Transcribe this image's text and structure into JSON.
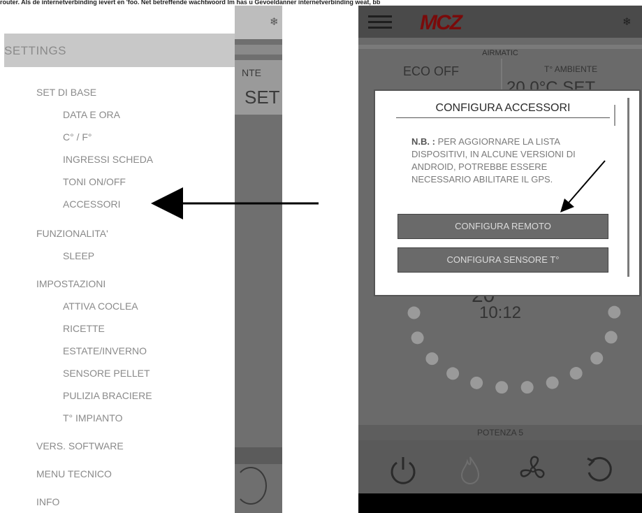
{
  "caption": "router. Als de internetverbinding ievert en 'foo. Net betreffende wachtwoord lm has u Gevoeldanner internetverbinding weat, bb",
  "left": {
    "drawer_title": "SETTINGS",
    "menu": [
      {
        "label": "SET DI BASE"
      },
      {
        "label": "DATA E ORA"
      },
      {
        "label": "C° / F°"
      },
      {
        "label": "INGRESSI SCHEDA"
      },
      {
        "label": "TONI ON/OFF"
      },
      {
        "label": "ACCESSORI"
      },
      {
        "label": "FUNZIONALITA'"
      },
      {
        "label": "SLEEP"
      },
      {
        "label": "IMPOSTAZIONI"
      },
      {
        "label": "ATTIVA COCLEA"
      },
      {
        "label": "RICETTE"
      },
      {
        "label": "ESTATE/INVERNO"
      },
      {
        "label": "SENSORE PELLET"
      },
      {
        "label": "PULIZIA BRACIERE"
      },
      {
        "label": "T° IMPIANTO"
      },
      {
        "label": "VERS. SOFTWARE"
      },
      {
        "label": "MENU TECNICO"
      },
      {
        "label": "INFO"
      }
    ],
    "bg_label": "NTE",
    "bg_set": "SET",
    "snow_icon": "❄"
  },
  "right": {
    "logo": "MCZ",
    "snow_icon": "❄",
    "airmatic": "AIRMATIC",
    "eco": "ECO OFF",
    "t_ambiente": "T° AMBIENTE",
    "temp": "20,0°C   SET",
    "big_value": "20",
    "time": "10:12",
    "potenza": "POTENZA 5"
  },
  "dialog": {
    "title": "CONFIGURA ACCESSORI",
    "note_bold": "N.B. :",
    "note_text": " PER AGGIORNARE LA LISTA DISPOSITIVI, IN ALCUNE VERSIONI DI ANDROID, POTREBBE ESSERE NECESSARIO ABILITARE IL GPS.",
    "btn_remote": "CONFIGURA REMOTO",
    "btn_sensor": "CONFIGURA SENSORE T°"
  },
  "colors": {
    "logo": "#7a0a0a",
    "drawer_header": "#c8c8c8",
    "button": "#6a6a6a"
  }
}
